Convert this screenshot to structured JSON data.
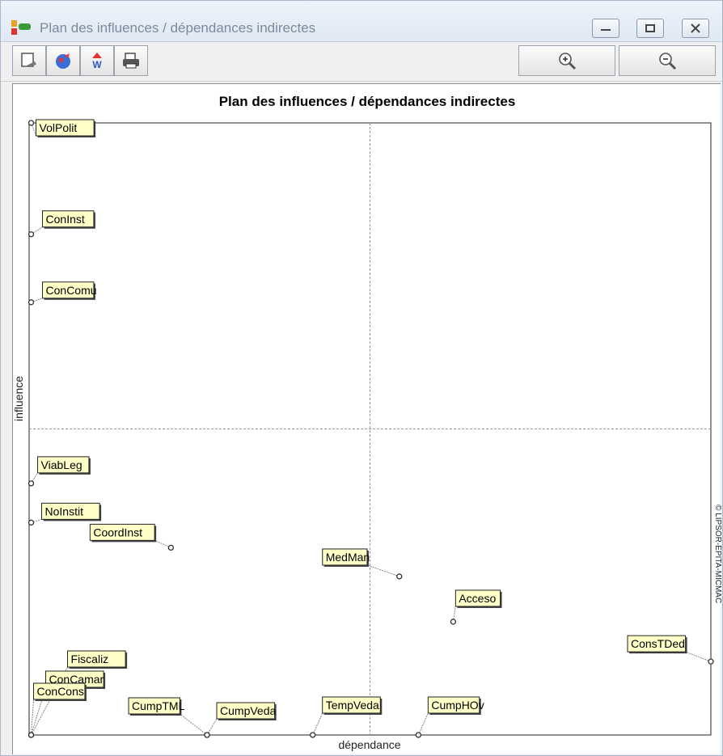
{
  "window": {
    "title": "Plan des influences / dépendances indirectes",
    "controls": [
      "minimize",
      "maximize",
      "close"
    ]
  },
  "toolbar": {
    "icons": [
      "copy-icon",
      "globe-icon",
      "color-palette-icon",
      "print-icon"
    ],
    "zoom_in_icon": "zoom-in-icon",
    "zoom_out_icon": "zoom-out-icon"
  },
  "chart_data": {
    "type": "scatter",
    "title": "Plan des influences / dépendances indirectes",
    "xlabel": "dépendance",
    "ylabel": "influence",
    "credit": "© LIPSOR-EPITA-MICMAC",
    "xlim": [
      0,
      100
    ],
    "ylim": [
      0,
      100
    ],
    "axis_ticks": false,
    "quadrant_lines": {
      "x": 50,
      "y": 50
    },
    "points": [
      {
        "label": "VolPolit",
        "x": 0.3,
        "y": 100.0
      },
      {
        "label": "ConInst",
        "x": 0.3,
        "y": 81.8
      },
      {
        "label": "ConComu",
        "x": 0.3,
        "y": 70.7
      },
      {
        "label": "ViabLeg",
        "x": 0.3,
        "y": 41.1
      },
      {
        "label": "NoInstit",
        "x": 0.3,
        "y": 34.7
      },
      {
        "label": "CoordInst",
        "x": 20.8,
        "y": 30.6
      },
      {
        "label": "MedMan",
        "x": 54.3,
        "y": 25.9
      },
      {
        "label": "Acceso",
        "x": 62.2,
        "y": 18.5
      },
      {
        "label": "ConsTDed",
        "x": 100.0,
        "y": 12.0
      },
      {
        "label": "Fiscaliz",
        "x": 0.3,
        "y": 0.0
      },
      {
        "label": "ConCamar",
        "x": 0.3,
        "y": 0.0
      },
      {
        "label": "ConCons",
        "x": 0.3,
        "y": 0.0
      },
      {
        "label": "CumpTML",
        "x": 26.1,
        "y": 0.0
      },
      {
        "label": "CumpVeda",
        "x": 26.1,
        "y": 0.0
      },
      {
        "label": "TempVeda",
        "x": 41.6,
        "y": 0.0
      },
      {
        "label": "CumpHOv",
        "x": 57.1,
        "y": 0.0
      }
    ]
  }
}
